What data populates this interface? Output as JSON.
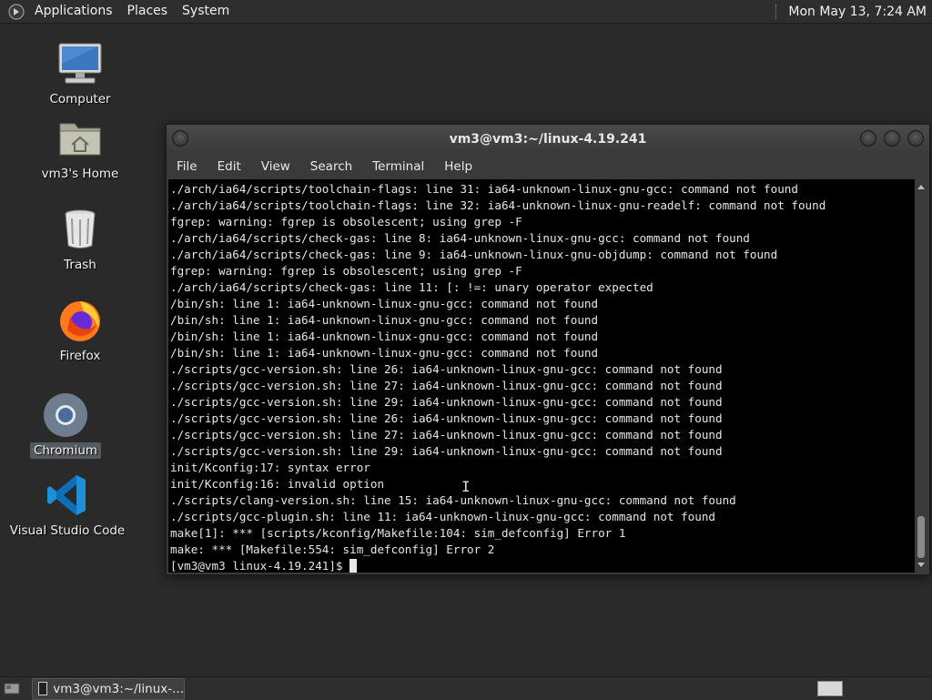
{
  "top_panel": {
    "menus": [
      "Applications",
      "Places",
      "System"
    ],
    "clock": "Mon May 13,  7:24 AM"
  },
  "desktop_icons": [
    {
      "label": "Computer",
      "icon": "computer-icon"
    },
    {
      "label": "vm3's Home",
      "icon": "home-folder-icon"
    },
    {
      "label": "Trash",
      "icon": "trash-icon"
    },
    {
      "label": "Firefox",
      "icon": "firefox-icon"
    },
    {
      "label": "Chromium",
      "icon": "chromium-icon",
      "selected": true
    },
    {
      "label": "Visual Studio Code",
      "icon": "vscode-icon"
    }
  ],
  "terminal": {
    "title": "vm3@vm3:~/linux-4.19.241",
    "menus": [
      "File",
      "Edit",
      "View",
      "Search",
      "Terminal",
      "Help"
    ],
    "lines": [
      "./arch/ia64/scripts/toolchain-flags: line 31: ia64-unknown-linux-gnu-gcc: command not found",
      "./arch/ia64/scripts/toolchain-flags: line 32: ia64-unknown-linux-gnu-readelf: command not found",
      "fgrep: warning: fgrep is obsolescent; using grep -F",
      "./arch/ia64/scripts/check-gas: line 8: ia64-unknown-linux-gnu-gcc: command not found",
      "./arch/ia64/scripts/check-gas: line 9: ia64-unknown-linux-gnu-objdump: command not found",
      "fgrep: warning: fgrep is obsolescent; using grep -F",
      "./arch/ia64/scripts/check-gas: line 11: [: !=: unary operator expected",
      "/bin/sh: line 1: ia64-unknown-linux-gnu-gcc: command not found",
      "/bin/sh: line 1: ia64-unknown-linux-gnu-gcc: command not found",
      "/bin/sh: line 1: ia64-unknown-linux-gnu-gcc: command not found",
      "/bin/sh: line 1: ia64-unknown-linux-gnu-gcc: command not found",
      "./scripts/gcc-version.sh: line 26: ia64-unknown-linux-gnu-gcc: command not found",
      "./scripts/gcc-version.sh: line 27: ia64-unknown-linux-gnu-gcc: command not found",
      "./scripts/gcc-version.sh: line 29: ia64-unknown-linux-gnu-gcc: command not found",
      "./scripts/gcc-version.sh: line 26: ia64-unknown-linux-gnu-gcc: command not found",
      "./scripts/gcc-version.sh: line 27: ia64-unknown-linux-gnu-gcc: command not found",
      "./scripts/gcc-version.sh: line 29: ia64-unknown-linux-gnu-gcc: command not found",
      "init/Kconfig:17: syntax error",
      "init/Kconfig:16: invalid option",
      "./scripts/clang-version.sh: line 15: ia64-unknown-linux-gnu-gcc: command not found",
      "./scripts/gcc-plugin.sh: line 11: ia64-unknown-linux-gnu-gcc: command not found",
      "make[1]: *** [scripts/kconfig/Makefile:104: sim_defconfig] Error 1",
      "make: *** [Makefile:554: sim_defconfig] Error 2"
    ],
    "prompt": "[vm3@vm3 linux-4.19.241]$ "
  },
  "bottom_panel": {
    "task_label": "vm3@vm3:~/linux-..."
  }
}
